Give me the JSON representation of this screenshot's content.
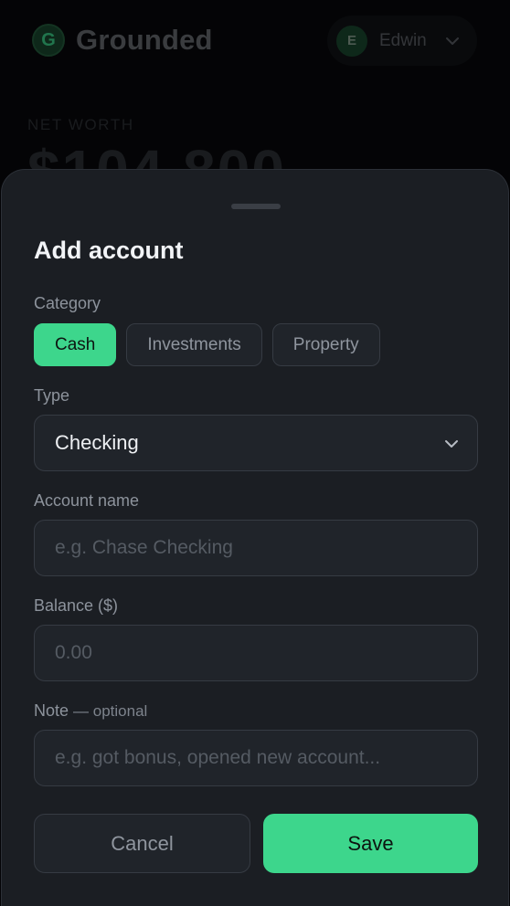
{
  "app": {
    "logo_letter": "G",
    "name": "Grounded",
    "user_initial": "E",
    "user_name": "Edwin"
  },
  "summary": {
    "net_worth_label": "NET WORTH",
    "net_worth_value": "$104,800"
  },
  "sheet": {
    "title": "Add account",
    "category_label": "Category",
    "categories": [
      "Cash",
      "Investments",
      "Property"
    ],
    "selected_category": "Cash",
    "type_label": "Type",
    "type_value": "Checking",
    "account_name_label": "Account name",
    "account_name_placeholder": "e.g. Chase Checking",
    "balance_label": "Balance ($)",
    "balance_placeholder": "0.00",
    "note_label": "Note",
    "note_optional": "— optional",
    "note_placeholder": "e.g. got bonus, opened new account...",
    "cancel_label": "Cancel",
    "save_label": "Save"
  },
  "colors": {
    "accent": "#3dd68c",
    "sheet_bg": "#1b1e23",
    "field_bg": "#20242a"
  },
  "icons": {
    "user_menu": "chevron-down-icon",
    "type_select": "chevron-down-icon"
  }
}
